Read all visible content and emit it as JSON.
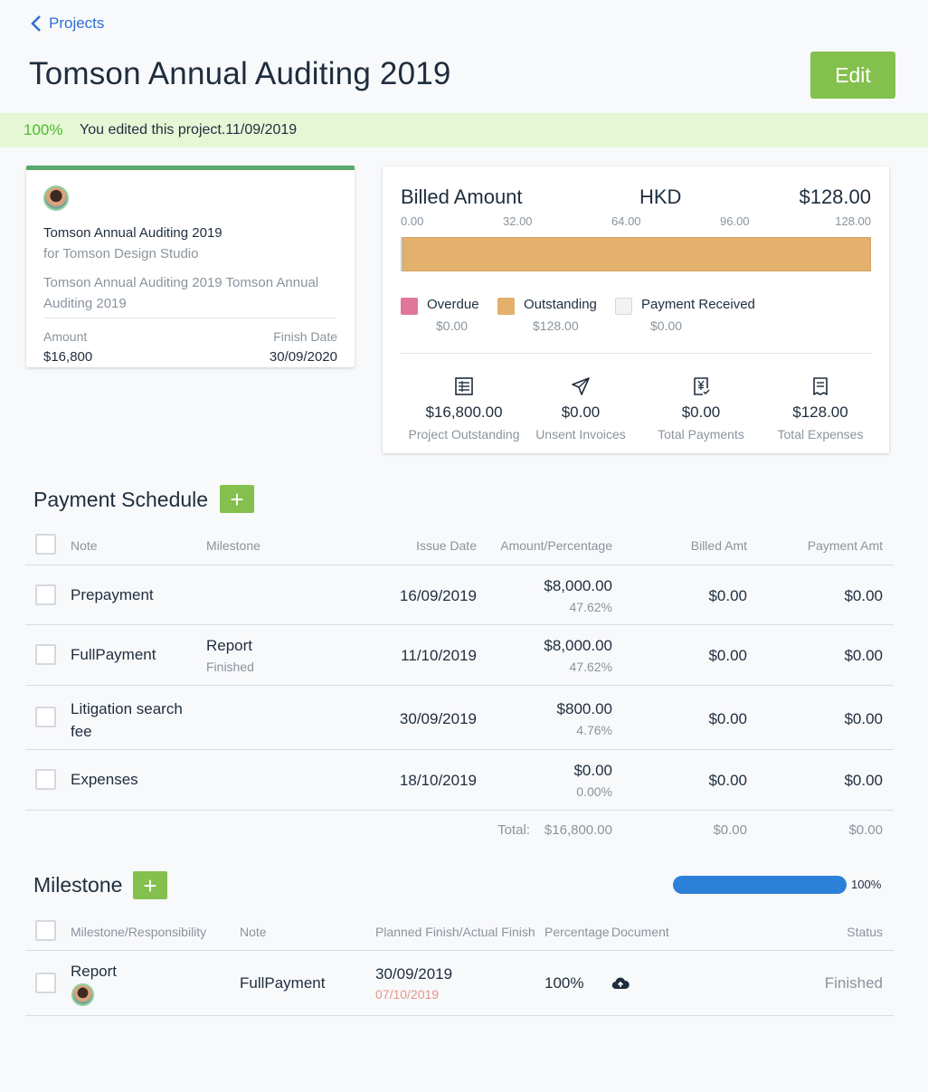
{
  "nav": {
    "back_label": "Projects"
  },
  "header": {
    "title": "Tomson Annual Auditing 2019",
    "edit_label": "Edit"
  },
  "banner": {
    "percent": "100%",
    "message": "You edited this project.11/09/2019"
  },
  "project_card": {
    "name": "Tomson Annual Auditing 2019",
    "client": "for Tomson Design Studio",
    "description": "Tomson Annual Auditing 2019 Tomson Annual Auditing 2019",
    "amount_label": "Amount",
    "amount_value": "$16,800",
    "finish_label": "Finish Date",
    "finish_value": "30/09/2020"
  },
  "billing": {
    "title": "Billed Amount",
    "currency": "HKD",
    "total": "$128.00",
    "ticks": [
      "0.00",
      "32.00",
      "64.00",
      "96.00",
      "128.00"
    ],
    "bar_fill_fraction": 1.0,
    "legend": [
      {
        "label": "Overdue",
        "value": "$0.00",
        "color": "#e0769a"
      },
      {
        "label": "Outstanding",
        "value": "$128.00",
        "color": "#e3b06d"
      },
      {
        "label": "Payment Received",
        "value": "$0.00",
        "color": "#f1f2f4"
      }
    ],
    "stats": [
      {
        "icon": "calculator-icon",
        "value": "$16,800.00",
        "label": "Project Outstanding"
      },
      {
        "icon": "paper-plane-icon",
        "value": "$0.00",
        "label": "Unsent Invoices"
      },
      {
        "icon": "yen-document-icon",
        "value": "$0.00",
        "label": "Total Payments"
      },
      {
        "icon": "receipt-icon",
        "value": "$128.00",
        "label": "Total Expenses"
      }
    ]
  },
  "payment_schedule": {
    "title": "Payment Schedule",
    "headers": {
      "note": "Note",
      "milestone": "Milestone",
      "issue_date": "Issue Date",
      "amount": "Amount/Percentage",
      "billed": "Billed Amt",
      "payment": "Payment Amt"
    },
    "rows": [
      {
        "note": "Prepayment",
        "milestone": "",
        "milestone_status": "",
        "issue_date": "16/09/2019",
        "amount": "$8,000.00",
        "percentage": "47.62%",
        "billed": "$0.00",
        "payment": "$0.00"
      },
      {
        "note": "FullPayment",
        "milestone": "Report",
        "milestone_status": "Finished",
        "issue_date": "11/10/2019",
        "amount": "$8,000.00",
        "percentage": "47.62%",
        "billed": "$0.00",
        "payment": "$0.00"
      },
      {
        "note": "Litigation search fee",
        "milestone": "",
        "milestone_status": "",
        "issue_date": "30/09/2019",
        "amount": "$800.00",
        "percentage": "4.76%",
        "billed": "$0.00",
        "payment": "$0.00"
      },
      {
        "note": "Expenses",
        "milestone": "",
        "milestone_status": "",
        "issue_date": "18/10/2019",
        "amount": "$0.00",
        "percentage": "0.00%",
        "billed": "$0.00",
        "payment": "$0.00"
      }
    ],
    "total": {
      "label": "Total:",
      "amount": "$16,800.00",
      "billed": "$0.00",
      "payment": "$0.00"
    }
  },
  "milestone": {
    "title": "Milestone",
    "progress_label": "100%",
    "progress_fraction": 1.0,
    "headers": {
      "name": "Milestone/Responsibility",
      "note": "Note",
      "finish": "Planned Finish/Actual Finish",
      "percentage": "Percentage",
      "document": "Document",
      "status": "Status"
    },
    "rows": [
      {
        "name": "Report",
        "note": "FullPayment",
        "planned": "30/09/2019",
        "actual": "07/10/2019",
        "percentage": "100%",
        "status": "Finished"
      }
    ]
  }
}
